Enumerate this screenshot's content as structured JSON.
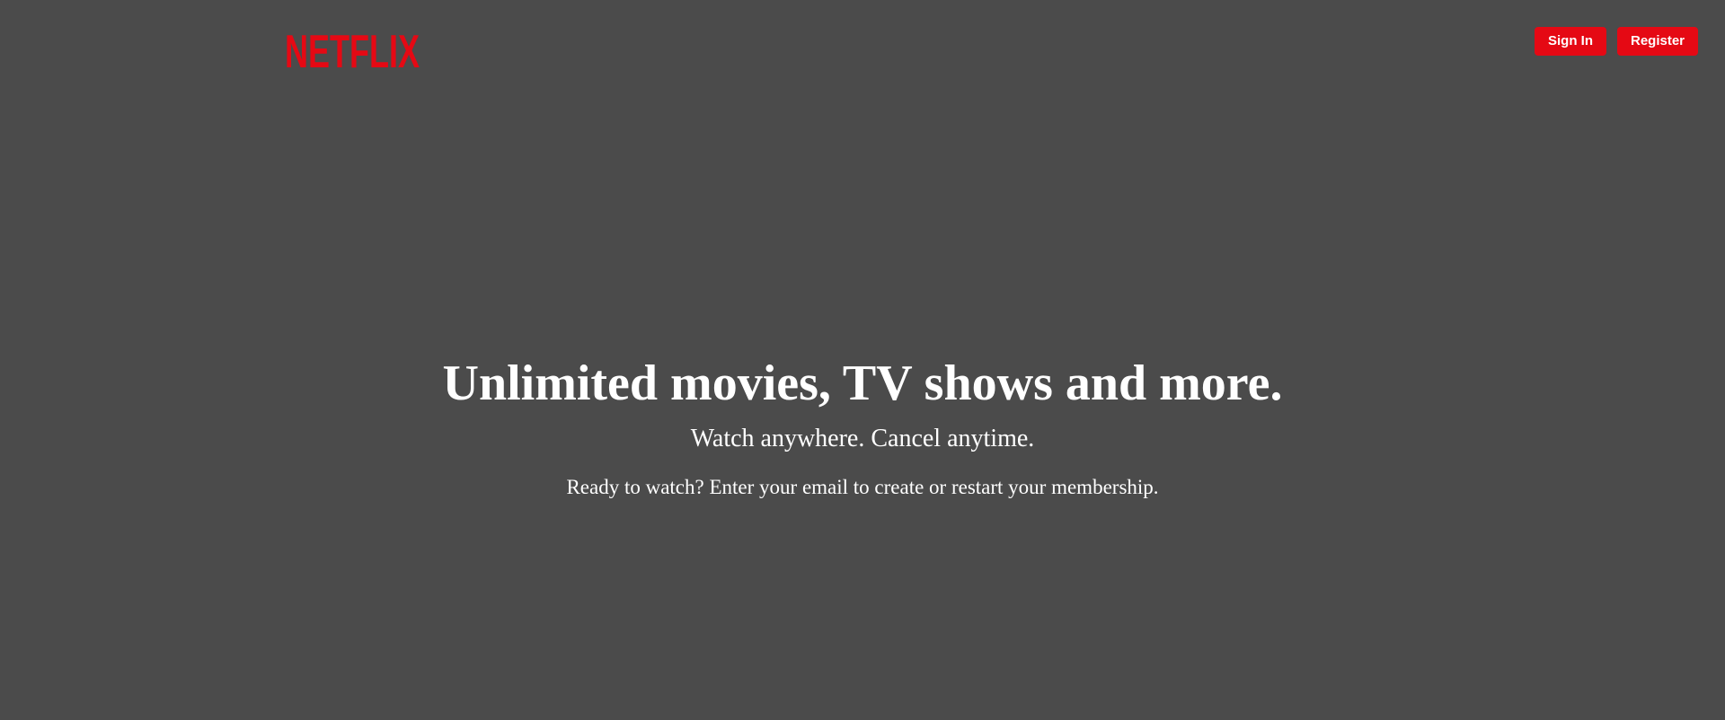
{
  "brand": {
    "logo_text": "NETFLIX",
    "logo_color": "#e50914"
  },
  "header": {
    "signin_label": "Sign In",
    "register_label": "Register"
  },
  "hero": {
    "title": "Unlimited movies, TV shows and more.",
    "subtitle": "Watch anywhere. Cancel anytime.",
    "cta_text": "Ready to watch? Enter your email to create or restart your membership."
  },
  "colors": {
    "background": "#4b4b4b",
    "accent": "#e50914",
    "text": "#ffffff"
  }
}
